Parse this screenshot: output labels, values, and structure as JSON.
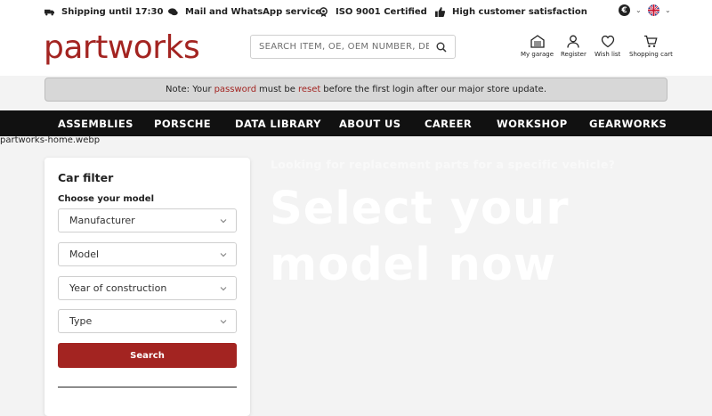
{
  "usp": {
    "shipping": "Shipping until 17:30",
    "service": "Mail and WhatsApp service",
    "iso": "ISO 9001 Certified",
    "satisfaction": "High customer satisfaction"
  },
  "currency": {
    "symbol": "€"
  },
  "brand": {
    "logo": "partworks",
    "color": "#a32421"
  },
  "search": {
    "placeholder": "SEARCH ITEM, OE, OEM NUMBER, DESCRI..."
  },
  "header_actions": {
    "garage": "My garage",
    "register": "Register",
    "wishlist": "Wish list",
    "cart": "Shopping cart"
  },
  "notice": {
    "before": "Note: Your",
    "link1": "password",
    "middle": "must be",
    "link2": "reset",
    "after": "before the first login after our major store update."
  },
  "nav": [
    "ASSEMBLIES",
    "PORSCHE",
    "DATA LIBRARY",
    "ABOUT US",
    "CAREER",
    "WORKSHOP",
    "GEARWORKS"
  ],
  "hero": {
    "image_alt": "partworks-home.webp",
    "kicker": "Looking for replacement parts for a specific vehicle?",
    "headline": "Select your model now"
  },
  "car_filter": {
    "title": "Car filter",
    "subtitle": "Choose your model",
    "manufacturer": "Manufacturer",
    "model": "Model",
    "year": "Year of construction",
    "type": "Type",
    "button": "Search"
  }
}
